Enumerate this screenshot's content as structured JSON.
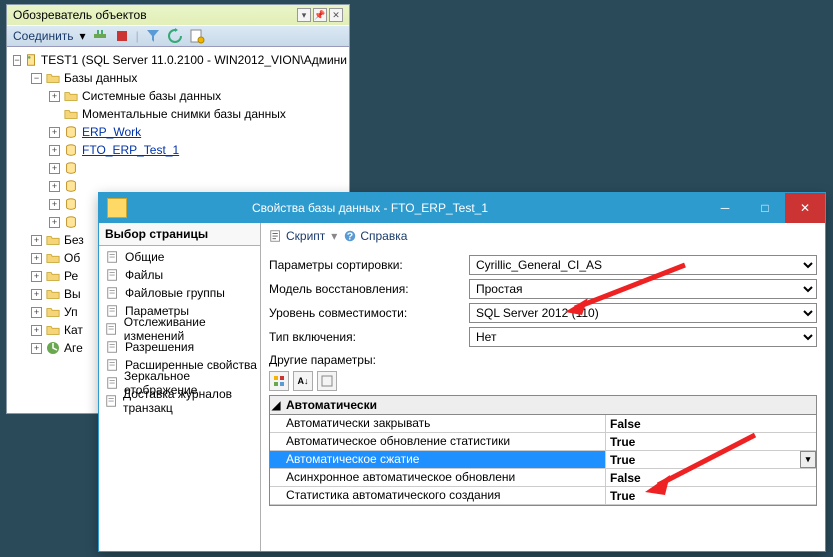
{
  "object_explorer": {
    "title": "Обозреватель объектов",
    "connect_label": "Соединить",
    "tree": {
      "root": "TEST1 (SQL Server 11.0.2100 - WIN2012_VION\\Админи",
      "databases": "Базы данных",
      "system_dbs": "Системные базы данных",
      "snapshots": "Моментальные снимки базы данных",
      "db1": "ERP_Work",
      "db2": "FTO_ERP_Test_1",
      "security": "Без",
      "objects": "Об",
      "replication": "Ре",
      "high_avail": "Вы",
      "management": "Уп",
      "catalogs": "Кат",
      "agent": "Аге"
    }
  },
  "dialog": {
    "title": "Свойства базы данных - FTO_ERP_Test_1",
    "page_selector": "Выбор страницы",
    "pages": [
      "Общие",
      "Файлы",
      "Файловые группы",
      "Параметры",
      "Отслеживание изменений",
      "Разрешения",
      "Расширенные свойства",
      "Зеркальное отображение",
      "Доставка журналов транзакц"
    ],
    "toolbar": {
      "script": "Скрипт",
      "help": "Справка"
    },
    "form": {
      "collation_label": "Параметры сортировки:",
      "collation_value": "Cyrillic_General_CI_AS",
      "recovery_label": "Модель восстановления:",
      "recovery_value": "Простая",
      "compat_label": "Уровень совместимости:",
      "compat_value": "SQL Server 2012 (110)",
      "containment_label": "Тип включения:",
      "containment_value": "Нет",
      "other_label": "Другие параметры:"
    },
    "propgrid": {
      "category": "Автоматически",
      "rows": [
        {
          "name": "Автоматически закрывать",
          "value": "False"
        },
        {
          "name": "Автоматическое обновление статистики",
          "value": "True"
        },
        {
          "name": "Автоматическое сжатие",
          "value": "True"
        },
        {
          "name": "Асинхронное автоматическое обновлени",
          "value": "False"
        },
        {
          "name": "Статистика автоматического создания",
          "value": "True"
        }
      ]
    }
  }
}
